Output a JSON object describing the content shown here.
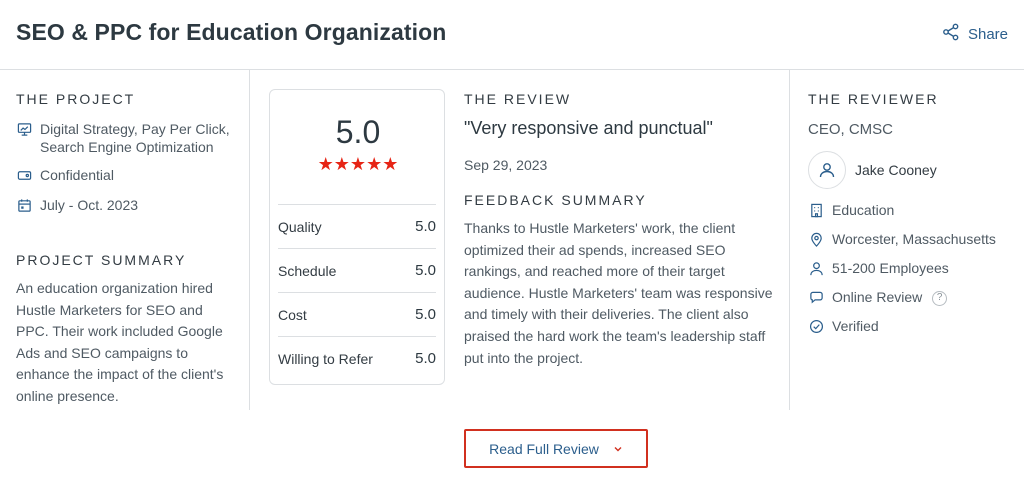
{
  "header": {
    "title": "SEO & PPC for Education Organization",
    "share_label": "Share"
  },
  "project": {
    "heading": "THE PROJECT",
    "services": "Digital Strategy, Pay Per Click, Search Engine Optimization",
    "budget": "Confidential",
    "timeline": "July - Oct. 2023",
    "summary_heading": "PROJECT SUMMARY",
    "summary": "An education organization hired Hustle Marketers for SEO and PPC. Their work included Google Ads and SEO campaigns to enhance the impact of the client's online presence."
  },
  "rating": {
    "overall": "5.0",
    "stars": "★★★★★",
    "rows": [
      {
        "label": "Quality",
        "value": "5.0"
      },
      {
        "label": "Schedule",
        "value": "5.0"
      },
      {
        "label": "Cost",
        "value": "5.0"
      },
      {
        "label": "Willing to Refer",
        "value": "5.0"
      }
    ]
  },
  "review": {
    "heading": "THE REVIEW",
    "quote": "\"Very responsive and punctual\"",
    "date": "Sep 29, 2023",
    "feedback_heading": "FEEDBACK SUMMARY",
    "feedback": "Thanks to Hustle Marketers' work, the client optimized their ad spends, increased SEO rankings, and reached more of their target audience. Hustle Marketers' team was responsive and timely with their deliveries. The client also praised the hard work the team's leadership staff put into the project."
  },
  "reviewer": {
    "heading": "THE REVIEWER",
    "role": "CEO, CMSC",
    "name": "Jake Cooney",
    "industry": "Education",
    "location": "Worcester, Massachusetts",
    "size": "51-200 Employees",
    "review_type": "Online Review",
    "help": "?",
    "verified": "Verified"
  },
  "actions": {
    "read_full": "Read Full Review"
  },
  "colors": {
    "accent_red": "#e62415",
    "link_blue": "#2b5e8c",
    "border": "#dcdfe2"
  }
}
